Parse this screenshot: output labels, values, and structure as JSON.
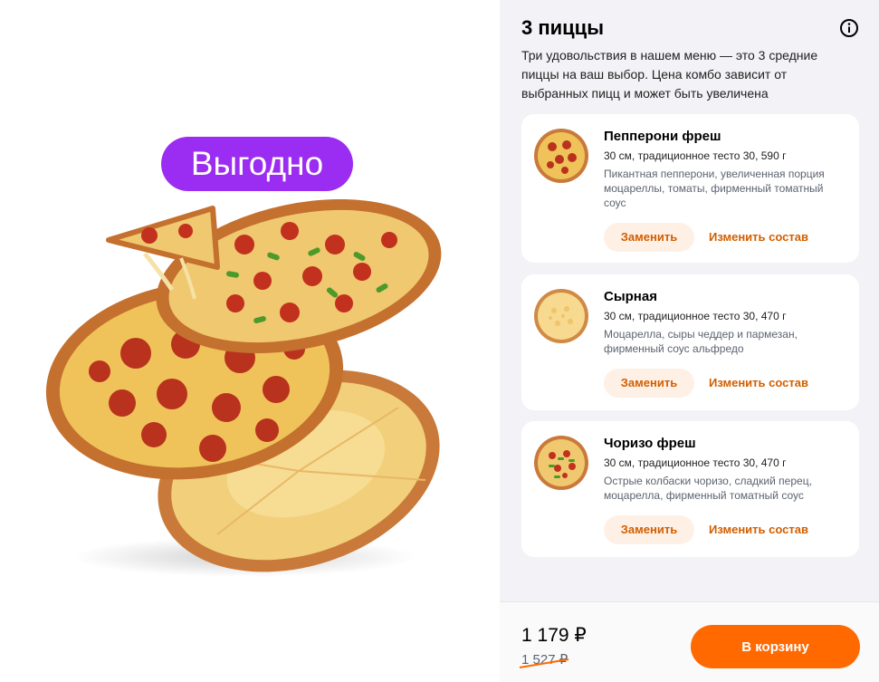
{
  "promo": {
    "badge": "Выгодно",
    "badge_color": "#9b2cf1"
  },
  "combo": {
    "title": "3 пиццы",
    "description": "Три удовольствия в нашем меню — это 3 средние пиццы на ваш выбор. Цена комбо зависит от выбранных пицц и может быть увеличена",
    "info_icon": "info-icon"
  },
  "items": [
    {
      "name": "Пепперони фреш",
      "spec": "30 см, традиционное тесто 30, 590 г",
      "ingredients": "Пикантная пепперони, увеличенная порция моцареллы, томаты, фирменный томатный соус",
      "replace_label": "Заменить",
      "change_label": "Изменить состав"
    },
    {
      "name": "Сырная",
      "spec": "30 см, традиционное тесто 30, 470 г",
      "ingredients": "Моцарелла, сыры чеддер и пармезан, фирменный соус альфредо",
      "replace_label": "Заменить",
      "change_label": "Изменить состав"
    },
    {
      "name": "Чоризо фреш",
      "spec": "30 см, традиционное тесто 30, 470 г",
      "ingredients": "Острые колбаски чоризо, сладкий перец, моцарелла, фирменный томатный соус",
      "replace_label": "Заменить",
      "change_label": "Изменить состав"
    }
  ],
  "footer": {
    "price": "1 179 ₽",
    "old_price": "1 527 ₽",
    "cart_label": "В корзину"
  },
  "colors": {
    "accent": "#ff6900",
    "accent_text": "#d15f00",
    "accent_soft": "#fff0e6",
    "panel_bg": "#f3f3f7"
  }
}
